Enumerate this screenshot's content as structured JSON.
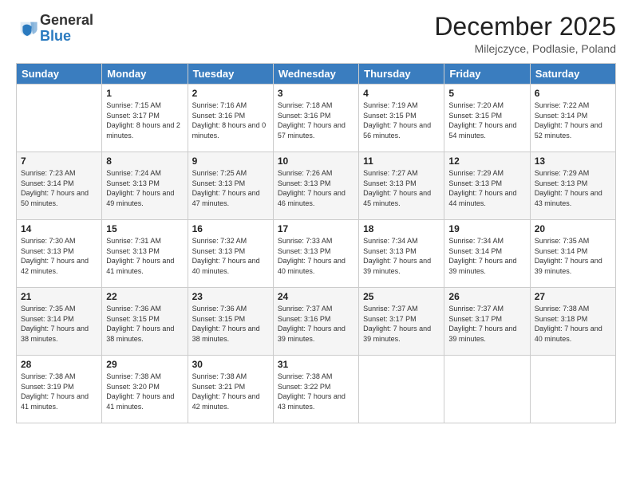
{
  "logo": {
    "general": "General",
    "blue": "Blue"
  },
  "header": {
    "month": "December 2025",
    "location": "Milejczyce, Podlasie, Poland"
  },
  "weekdays": [
    "Sunday",
    "Monday",
    "Tuesday",
    "Wednesday",
    "Thursday",
    "Friday",
    "Saturday"
  ],
  "weeks": [
    [
      {
        "day": "",
        "sunrise": "",
        "sunset": "",
        "daylight": ""
      },
      {
        "day": "1",
        "sunrise": "Sunrise: 7:15 AM",
        "sunset": "Sunset: 3:17 PM",
        "daylight": "Daylight: 8 hours and 2 minutes."
      },
      {
        "day": "2",
        "sunrise": "Sunrise: 7:16 AM",
        "sunset": "Sunset: 3:16 PM",
        "daylight": "Daylight: 8 hours and 0 minutes."
      },
      {
        "day": "3",
        "sunrise": "Sunrise: 7:18 AM",
        "sunset": "Sunset: 3:16 PM",
        "daylight": "Daylight: 7 hours and 57 minutes."
      },
      {
        "day": "4",
        "sunrise": "Sunrise: 7:19 AM",
        "sunset": "Sunset: 3:15 PM",
        "daylight": "Daylight: 7 hours and 56 minutes."
      },
      {
        "day": "5",
        "sunrise": "Sunrise: 7:20 AM",
        "sunset": "Sunset: 3:15 PM",
        "daylight": "Daylight: 7 hours and 54 minutes."
      },
      {
        "day": "6",
        "sunrise": "Sunrise: 7:22 AM",
        "sunset": "Sunset: 3:14 PM",
        "daylight": "Daylight: 7 hours and 52 minutes."
      }
    ],
    [
      {
        "day": "7",
        "sunrise": "Sunrise: 7:23 AM",
        "sunset": "Sunset: 3:14 PM",
        "daylight": "Daylight: 7 hours and 50 minutes."
      },
      {
        "day": "8",
        "sunrise": "Sunrise: 7:24 AM",
        "sunset": "Sunset: 3:13 PM",
        "daylight": "Daylight: 7 hours and 49 minutes."
      },
      {
        "day": "9",
        "sunrise": "Sunrise: 7:25 AM",
        "sunset": "Sunset: 3:13 PM",
        "daylight": "Daylight: 7 hours and 47 minutes."
      },
      {
        "day": "10",
        "sunrise": "Sunrise: 7:26 AM",
        "sunset": "Sunset: 3:13 PM",
        "daylight": "Daylight: 7 hours and 46 minutes."
      },
      {
        "day": "11",
        "sunrise": "Sunrise: 7:27 AM",
        "sunset": "Sunset: 3:13 PM",
        "daylight": "Daylight: 7 hours and 45 minutes."
      },
      {
        "day": "12",
        "sunrise": "Sunrise: 7:29 AM",
        "sunset": "Sunset: 3:13 PM",
        "daylight": "Daylight: 7 hours and 44 minutes."
      },
      {
        "day": "13",
        "sunrise": "Sunrise: 7:29 AM",
        "sunset": "Sunset: 3:13 PM",
        "daylight": "Daylight: 7 hours and 43 minutes."
      }
    ],
    [
      {
        "day": "14",
        "sunrise": "Sunrise: 7:30 AM",
        "sunset": "Sunset: 3:13 PM",
        "daylight": "Daylight: 7 hours and 42 minutes."
      },
      {
        "day": "15",
        "sunrise": "Sunrise: 7:31 AM",
        "sunset": "Sunset: 3:13 PM",
        "daylight": "Daylight: 7 hours and 41 minutes."
      },
      {
        "day": "16",
        "sunrise": "Sunrise: 7:32 AM",
        "sunset": "Sunset: 3:13 PM",
        "daylight": "Daylight: 7 hours and 40 minutes."
      },
      {
        "day": "17",
        "sunrise": "Sunrise: 7:33 AM",
        "sunset": "Sunset: 3:13 PM",
        "daylight": "Daylight: 7 hours and 40 minutes."
      },
      {
        "day": "18",
        "sunrise": "Sunrise: 7:34 AM",
        "sunset": "Sunset: 3:13 PM",
        "daylight": "Daylight: 7 hours and 39 minutes."
      },
      {
        "day": "19",
        "sunrise": "Sunrise: 7:34 AM",
        "sunset": "Sunset: 3:14 PM",
        "daylight": "Daylight: 7 hours and 39 minutes."
      },
      {
        "day": "20",
        "sunrise": "Sunrise: 7:35 AM",
        "sunset": "Sunset: 3:14 PM",
        "daylight": "Daylight: 7 hours and 39 minutes."
      }
    ],
    [
      {
        "day": "21",
        "sunrise": "Sunrise: 7:35 AM",
        "sunset": "Sunset: 3:14 PM",
        "daylight": "Daylight: 7 hours and 38 minutes."
      },
      {
        "day": "22",
        "sunrise": "Sunrise: 7:36 AM",
        "sunset": "Sunset: 3:15 PM",
        "daylight": "Daylight: 7 hours and 38 minutes."
      },
      {
        "day": "23",
        "sunrise": "Sunrise: 7:36 AM",
        "sunset": "Sunset: 3:15 PM",
        "daylight": "Daylight: 7 hours and 38 minutes."
      },
      {
        "day": "24",
        "sunrise": "Sunrise: 7:37 AM",
        "sunset": "Sunset: 3:16 PM",
        "daylight": "Daylight: 7 hours and 39 minutes."
      },
      {
        "day": "25",
        "sunrise": "Sunrise: 7:37 AM",
        "sunset": "Sunset: 3:17 PM",
        "daylight": "Daylight: 7 hours and 39 minutes."
      },
      {
        "day": "26",
        "sunrise": "Sunrise: 7:37 AM",
        "sunset": "Sunset: 3:17 PM",
        "daylight": "Daylight: 7 hours and 39 minutes."
      },
      {
        "day": "27",
        "sunrise": "Sunrise: 7:38 AM",
        "sunset": "Sunset: 3:18 PM",
        "daylight": "Daylight: 7 hours and 40 minutes."
      }
    ],
    [
      {
        "day": "28",
        "sunrise": "Sunrise: 7:38 AM",
        "sunset": "Sunset: 3:19 PM",
        "daylight": "Daylight: 7 hours and 41 minutes."
      },
      {
        "day": "29",
        "sunrise": "Sunrise: 7:38 AM",
        "sunset": "Sunset: 3:20 PM",
        "daylight": "Daylight: 7 hours and 41 minutes."
      },
      {
        "day": "30",
        "sunrise": "Sunrise: 7:38 AM",
        "sunset": "Sunset: 3:21 PM",
        "daylight": "Daylight: 7 hours and 42 minutes."
      },
      {
        "day": "31",
        "sunrise": "Sunrise: 7:38 AM",
        "sunset": "Sunset: 3:22 PM",
        "daylight": "Daylight: 7 hours and 43 minutes."
      },
      {
        "day": "",
        "sunrise": "",
        "sunset": "",
        "daylight": ""
      },
      {
        "day": "",
        "sunrise": "",
        "sunset": "",
        "daylight": ""
      },
      {
        "day": "",
        "sunrise": "",
        "sunset": "",
        "daylight": ""
      }
    ]
  ]
}
